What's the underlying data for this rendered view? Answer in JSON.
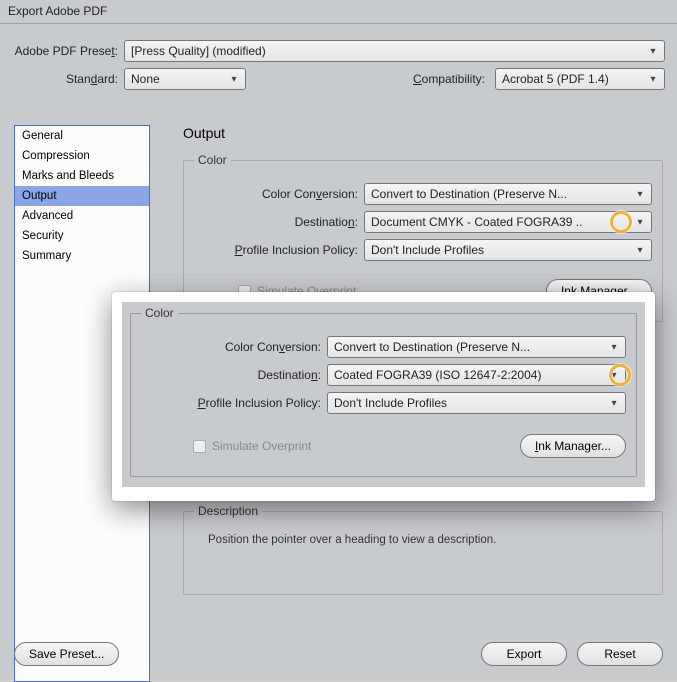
{
  "window": {
    "title": "Export Adobe PDF"
  },
  "top": {
    "preset_label": "Adobe PDF Preset:",
    "preset_value": "[Press Quality] (modified)",
    "standard_label": "Standard:",
    "standard_value": "None",
    "compat_label": "Compatibility:",
    "compat_value": "Acrobat 5 (PDF 1.4)"
  },
  "sidebar": {
    "items": [
      "General",
      "Compression",
      "Marks and Bleeds",
      "Output",
      "Advanced",
      "Security",
      "Summary"
    ],
    "selected": 3
  },
  "pane": {
    "title": "Output",
    "color": {
      "legend": "Color",
      "conversion_label": "Color Conversion:",
      "conversion_value": "Convert to Destination (Preserve N...",
      "destination_label": "Destination:",
      "destination_value": "Document CMYK - Coated FOGRA39 ..",
      "policy_label": "Profile Inclusion Policy:",
      "policy_value": "Don't Include Profiles",
      "simulate_label": "Simulate Overprint",
      "ink_btn": "Ink Manager..."
    },
    "description": {
      "legend": "Description",
      "text": "Position the pointer over a heading to view a description."
    }
  },
  "overlay": {
    "legend": "Color",
    "conversion_label": "Color Conversion:",
    "conversion_value": "Convert to Destination (Preserve N...",
    "destination_label": "Destination:",
    "destination_value": "Coated FOGRA39 (ISO 12647-2:2004)",
    "policy_label": "Profile Inclusion Policy:",
    "policy_value": "Don't Include Profiles",
    "simulate_label": "Simulate Overprint",
    "ink_btn": "Ink Manager..."
  },
  "footer": {
    "save_preset": "Save Preset...",
    "export": "Export",
    "reset": "Reset"
  }
}
